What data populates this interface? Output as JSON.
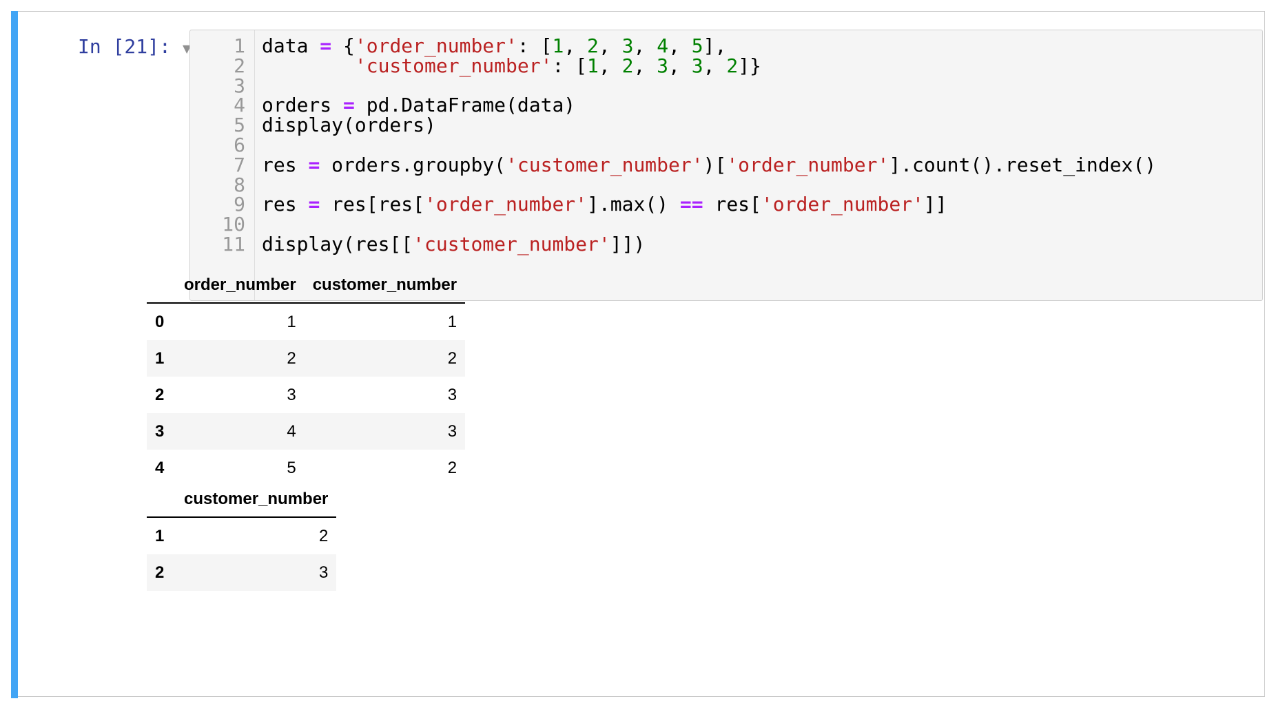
{
  "prompt": "In [21]:",
  "code_lines": [
    {
      "n": "1",
      "tokens": [
        {
          "t": "data ",
          "c": ""
        },
        {
          "t": "=",
          "c": "op"
        },
        {
          "t": " {",
          "c": ""
        },
        {
          "t": "'order_number'",
          "c": "str"
        },
        {
          "t": ": [",
          "c": ""
        },
        {
          "t": "1",
          "c": "num"
        },
        {
          "t": ", ",
          "c": ""
        },
        {
          "t": "2",
          "c": "num"
        },
        {
          "t": ", ",
          "c": ""
        },
        {
          "t": "3",
          "c": "num"
        },
        {
          "t": ", ",
          "c": ""
        },
        {
          "t": "4",
          "c": "num"
        },
        {
          "t": ", ",
          "c": ""
        },
        {
          "t": "5",
          "c": "num"
        },
        {
          "t": "],",
          "c": ""
        }
      ]
    },
    {
      "n": "2",
      "tokens": [
        {
          "t": "        ",
          "c": ""
        },
        {
          "t": "'customer_number'",
          "c": "str"
        },
        {
          "t": ": [",
          "c": ""
        },
        {
          "t": "1",
          "c": "num"
        },
        {
          "t": ", ",
          "c": ""
        },
        {
          "t": "2",
          "c": "num"
        },
        {
          "t": ", ",
          "c": ""
        },
        {
          "t": "3",
          "c": "num"
        },
        {
          "t": ", ",
          "c": ""
        },
        {
          "t": "3",
          "c": "num"
        },
        {
          "t": ", ",
          "c": ""
        },
        {
          "t": "2",
          "c": "num"
        },
        {
          "t": "]}",
          "c": ""
        }
      ]
    },
    {
      "n": "3",
      "tokens": []
    },
    {
      "n": "4",
      "tokens": [
        {
          "t": "orders ",
          "c": ""
        },
        {
          "t": "=",
          "c": "op"
        },
        {
          "t": " pd.DataFrame(data)",
          "c": ""
        }
      ]
    },
    {
      "n": "5",
      "tokens": [
        {
          "t": "display(orders)",
          "c": ""
        }
      ]
    },
    {
      "n": "6",
      "tokens": []
    },
    {
      "n": "7",
      "tokens": [
        {
          "t": "res ",
          "c": ""
        },
        {
          "t": "=",
          "c": "op"
        },
        {
          "t": " orders.groupby(",
          "c": ""
        },
        {
          "t": "'customer_number'",
          "c": "str"
        },
        {
          "t": ")[",
          "c": ""
        },
        {
          "t": "'order_number'",
          "c": "str"
        },
        {
          "t": "].count().reset_index()",
          "c": ""
        }
      ]
    },
    {
      "n": "8",
      "tokens": []
    },
    {
      "n": "9",
      "tokens": [
        {
          "t": "res ",
          "c": ""
        },
        {
          "t": "=",
          "c": "op"
        },
        {
          "t": " res[res[",
          "c": ""
        },
        {
          "t": "'order_number'",
          "c": "str"
        },
        {
          "t": "].max() ",
          "c": ""
        },
        {
          "t": "==",
          "c": "op"
        },
        {
          "t": " res[",
          "c": ""
        },
        {
          "t": "'order_number'",
          "c": "str"
        },
        {
          "t": "]]",
          "c": ""
        }
      ]
    },
    {
      "n": "10",
      "tokens": []
    },
    {
      "n": "11",
      "tokens": [
        {
          "t": "display(res[[",
          "c": ""
        },
        {
          "t": "'customer_number'",
          "c": "str"
        },
        {
          "t": "]])",
          "c": ""
        }
      ]
    }
  ],
  "output_table_1": {
    "columns": [
      "",
      "order_number",
      "customer_number"
    ],
    "rows": [
      [
        "0",
        "1",
        "1"
      ],
      [
        "1",
        "2",
        "2"
      ],
      [
        "2",
        "3",
        "3"
      ],
      [
        "3",
        "4",
        "3"
      ],
      [
        "4",
        "5",
        "2"
      ]
    ]
  },
  "output_table_2": {
    "columns": [
      "",
      "customer_number"
    ],
    "rows": [
      [
        "1",
        "2"
      ],
      [
        "2",
        "3"
      ]
    ]
  },
  "colors": {
    "cell_indicator": "#42a5f5",
    "prompt": "#303f9f",
    "operator": "#aa22ff",
    "string": "#ba2121",
    "number": "#008000"
  },
  "icons": {
    "collapse": "triangle-down-icon"
  }
}
